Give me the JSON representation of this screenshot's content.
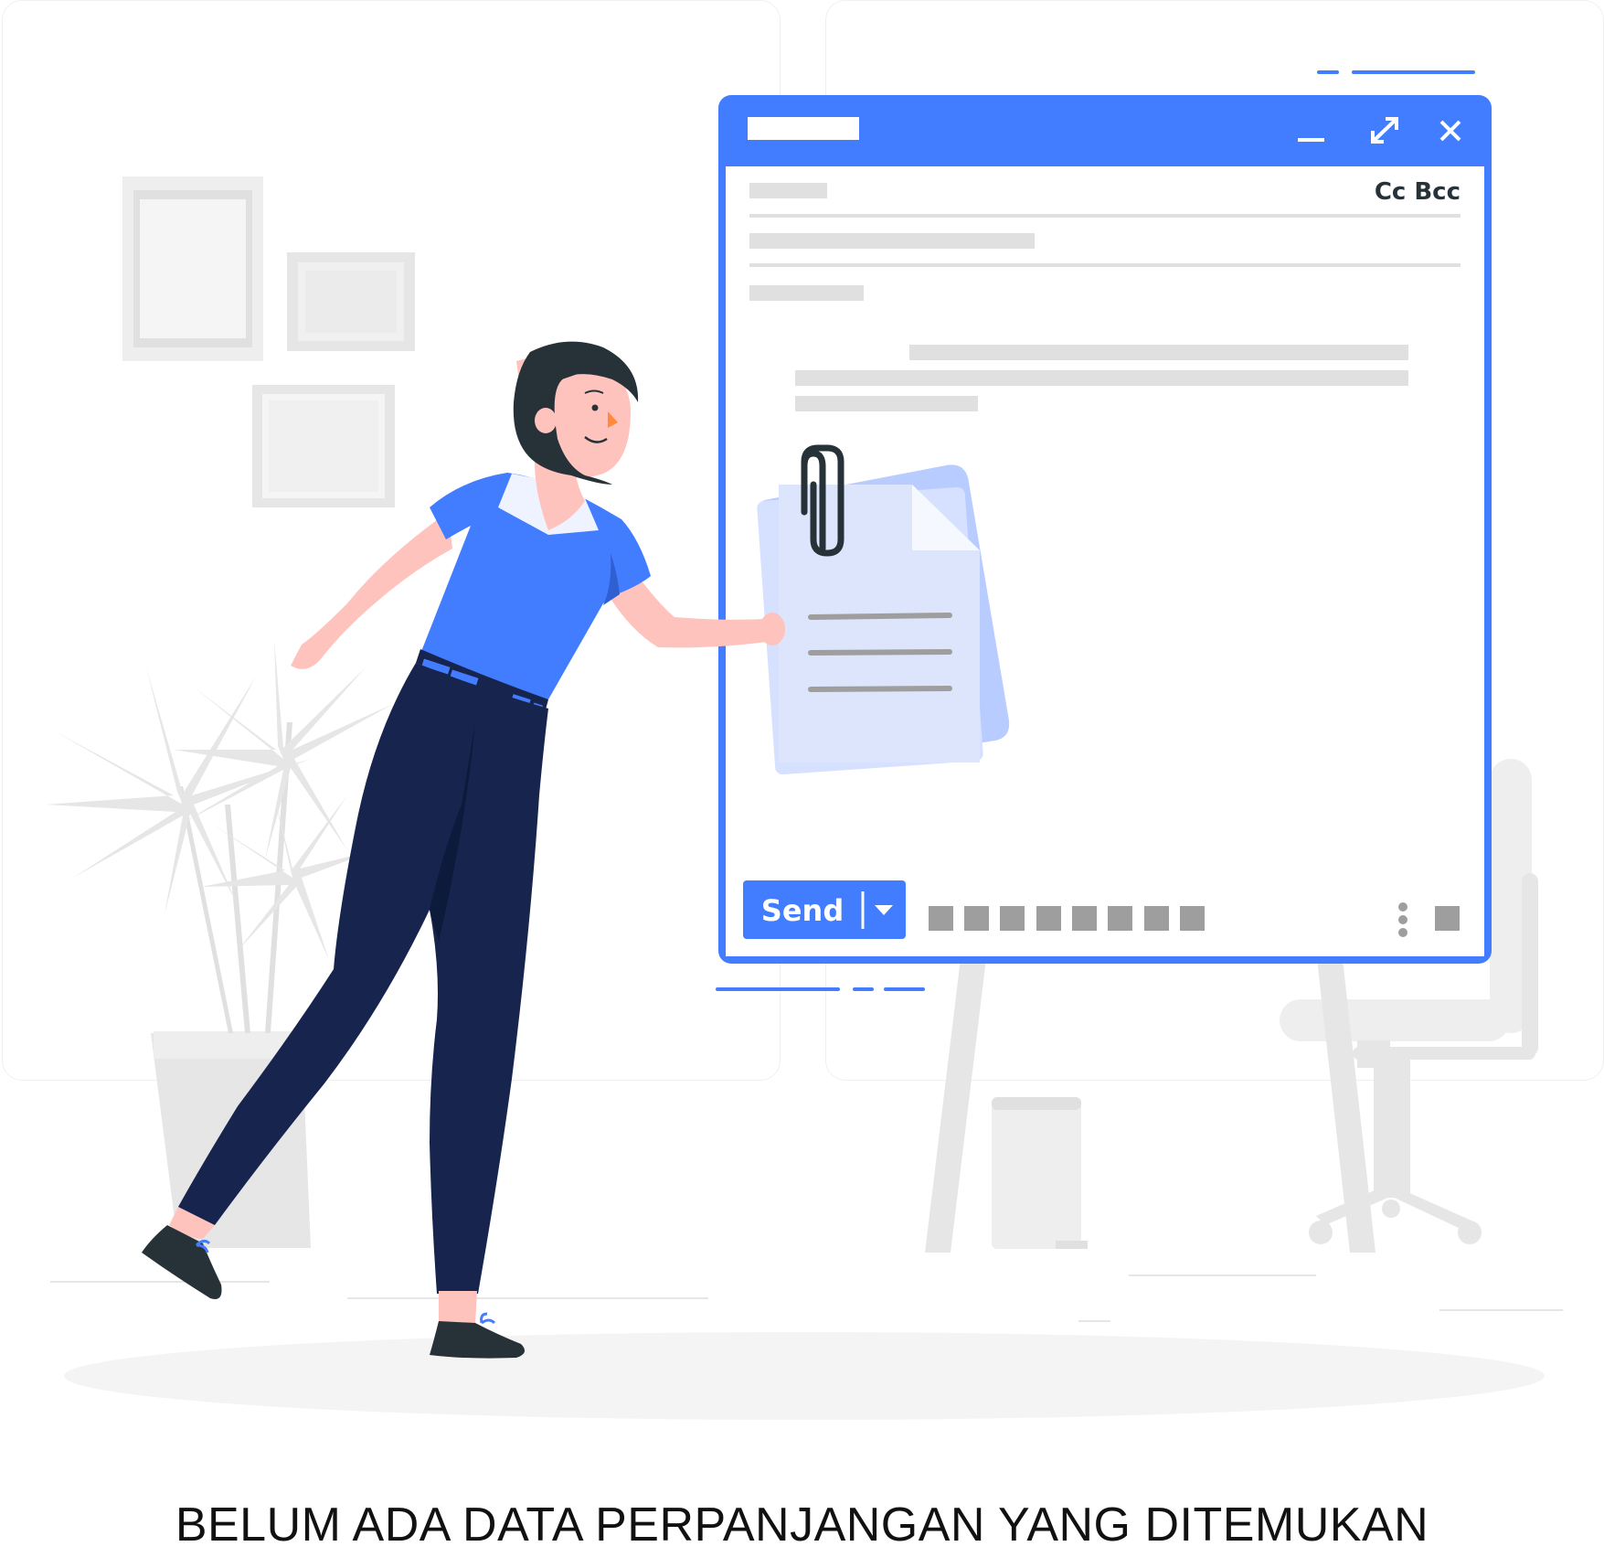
{
  "compose_window": {
    "cc_bcc_label": "Cc Bcc",
    "send_label": "Send",
    "minimize_icon": "minimize-icon",
    "expand_icon": "expand-icon",
    "close_icon": "close-icon",
    "more_icon": "more-vertical-icon",
    "dropdown_icon": "caret-down-icon",
    "accent_color": "#427cff"
  },
  "illustration": {
    "attachment_icon": "paperclip-icon",
    "document_icon": "document-icon"
  },
  "empty_state": {
    "message": "BELUM ADA DATA PERPANJANGAN YANG DITEMUKAN"
  }
}
